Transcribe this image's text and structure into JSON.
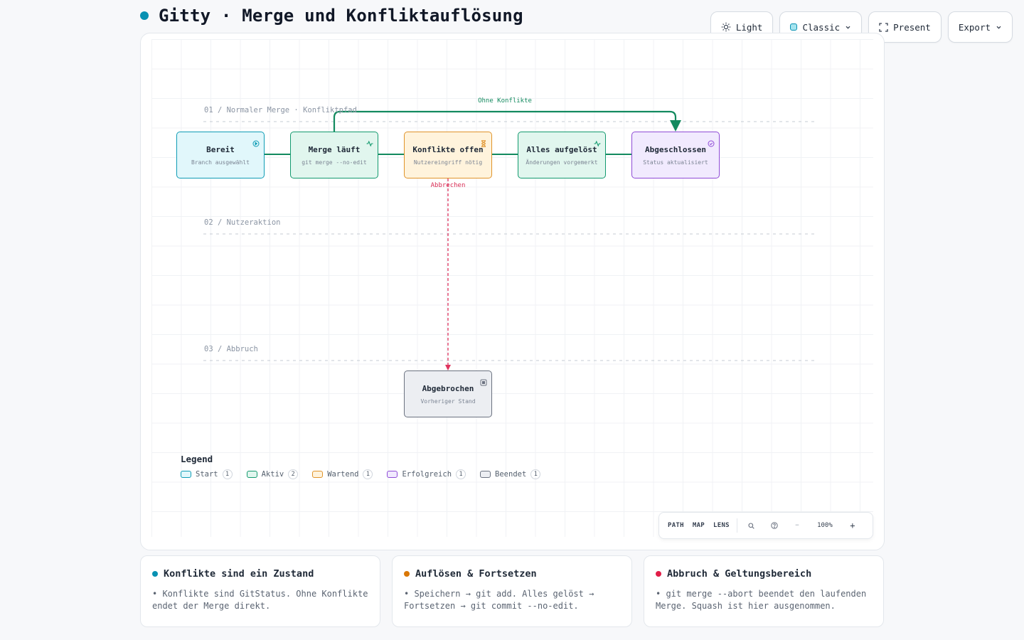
{
  "header": {
    "title": "Gitty · Merge und Konfliktauflösung",
    "accent": "#0891b2"
  },
  "toolbar": {
    "theme_label": "Light",
    "style_label": "Classic",
    "present_label": "Present",
    "export_label": "Export"
  },
  "lanes": [
    {
      "label": "01 / Normaler Merge · Konfliktpfad"
    },
    {
      "label": "02 / Nutzeraktion"
    },
    {
      "label": "03 / Abbruch"
    }
  ],
  "nodes": {
    "bereit": {
      "title": "Bereit",
      "subtitle": "Branch ausgewählt",
      "kind": "start",
      "icon": "play-circle-icon"
    },
    "merge": {
      "title": "Merge läuft",
      "subtitle": "git merge --no-edit",
      "kind": "active",
      "icon": "activity-icon"
    },
    "konflikte": {
      "title": "Konflikte offen",
      "subtitle": "Nutzereingriff nötig",
      "kind": "waiting",
      "icon": "hourglass-icon"
    },
    "aufgeloest": {
      "title": "Alles aufgelöst",
      "subtitle": "Änderungen vorgemerkt",
      "kind": "active",
      "icon": "activity-icon"
    },
    "abgeschlossen": {
      "title": "Abgeschlossen",
      "subtitle": "Status aktualisiert",
      "kind": "success",
      "icon": "check-circle-icon"
    },
    "abgebrochen": {
      "title": "Abgebrochen",
      "subtitle": "Vorheriger Stand",
      "kind": "ended",
      "icon": "stop-square-icon"
    }
  },
  "edges": [
    {
      "from": "bereit",
      "to": "merge",
      "label": ""
    },
    {
      "from": "merge",
      "to": "konflikte",
      "label": ""
    },
    {
      "from": "konflikte",
      "to": "aufgeloest",
      "label": ""
    },
    {
      "from": "aufgeloest",
      "to": "abgeschlossen",
      "label": ""
    },
    {
      "from": "merge",
      "to": "abgeschlossen",
      "label": "Ohne Konflikte"
    },
    {
      "from": "konflikte",
      "to": "abgebrochen",
      "label": "Abbrechen"
    }
  ],
  "legend": {
    "title": "Legend",
    "items": [
      {
        "label": "Start",
        "count": "1",
        "color": "#0e9cb5",
        "fill": "#e1f7fb"
      },
      {
        "label": "Aktiv",
        "count": "2",
        "color": "#139a6e",
        "fill": "#e1f6ee"
      },
      {
        "label": "Wartend",
        "count": "1",
        "color": "#e0932a",
        "fill": "#fff3dc"
      },
      {
        "label": "Erfolgreich",
        "count": "1",
        "color": "#8f4bd6",
        "fill": "#f1eafe"
      },
      {
        "label": "Beendet",
        "count": "1",
        "color": "#6b7280",
        "fill": "#eceef2"
      }
    ]
  },
  "zoom_bar": {
    "path": "PATH",
    "map": "MAP",
    "lens": "LENS",
    "zoom": "100%",
    "minus": "−",
    "plus": "+"
  },
  "cards": [
    {
      "title": "Konflikte sind ein Zustand",
      "text": "• Konflikte sind GitStatus. Ohne Konflikte endet der Merge direkt.",
      "color": "#0891b2"
    },
    {
      "title": "Auflösen & Fortsetzen",
      "text": "• Speichern → git add. Alles gelöst → Fortsetzen → git commit --no-edit.",
      "color": "#d97706"
    },
    {
      "title": "Abbruch & Geltungsbereich",
      "text": "• git merge --abort beendet den laufenden Merge. Squash ist hier ausgenommen.",
      "color": "#e11d48"
    }
  ],
  "colors": {
    "success_edge": "#138a5f",
    "abort_edge": "#e0335e",
    "lane_rule": "#c5cbd3"
  }
}
